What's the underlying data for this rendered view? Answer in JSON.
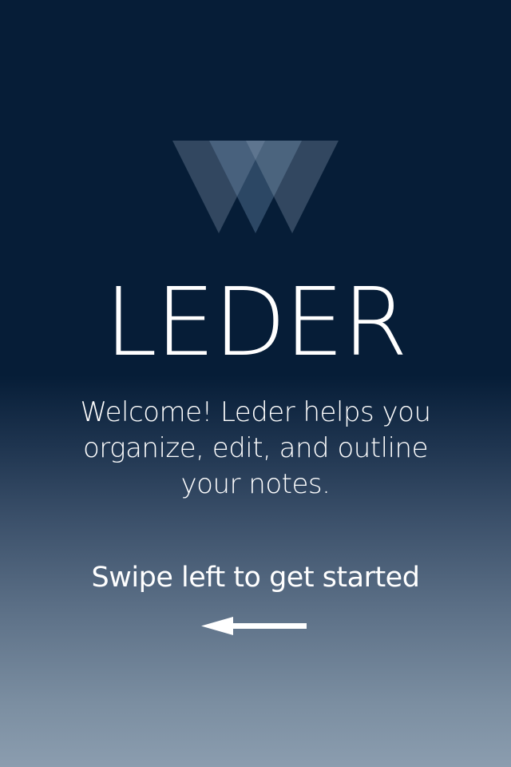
{
  "onboarding": {
    "app_name": "LEDER",
    "welcome_lines": [
      "Welcome! Leder helps you",
      "organize, edit, and outline",
      "your notes."
    ],
    "swipe_hint": "Swipe left to get started",
    "logo_icon": "leder-w-logo-icon",
    "arrow_icon": "arrow-left-icon"
  },
  "colors": {
    "background_top": "#061d37",
    "background_bottom": "#8b9daf",
    "text": "#ffffff"
  }
}
